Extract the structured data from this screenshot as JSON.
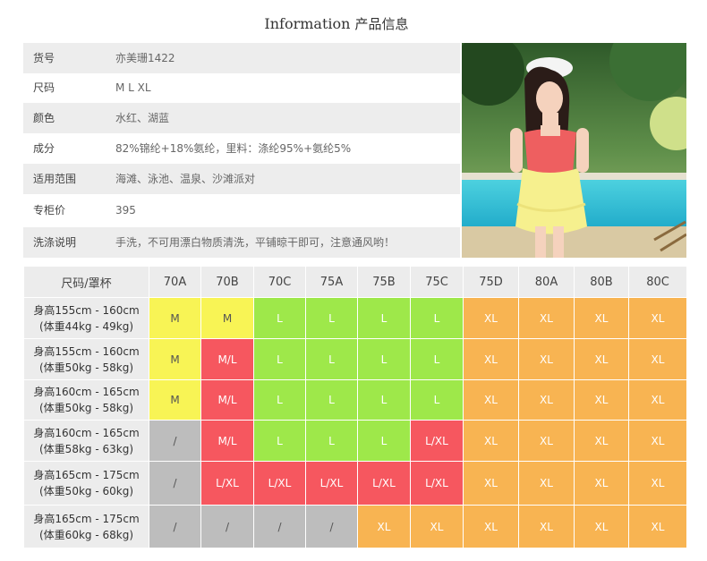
{
  "title": {
    "en": "Information",
    "zh": "产品信息"
  },
  "info": [
    {
      "label": "货号",
      "value": "亦美珊1422"
    },
    {
      "label": "尺码",
      "value": "M    L    XL"
    },
    {
      "label": "颜色",
      "value": "水红、湖蓝"
    },
    {
      "label": "成分",
      "value": "82%锦纶+18%氨纶，里料：涤纶95%+氨纶5%"
    },
    {
      "label": "适用范围",
      "value": "海滩、泳池、温泉、沙滩派对"
    },
    {
      "label": "专柜价",
      "value": "395"
    },
    {
      "label": "洗涤说明",
      "value": "手洗，不可用漂白物质清洗，平铺晾干即可，注意通风哟！"
    }
  ],
  "colors": {
    "yellow": "#f8f455",
    "red": "#f6575f",
    "green": "#9ee84a",
    "orange": "#f8b452",
    "gray": "#bdbdbd",
    "header": "#ececec"
  },
  "size_table": {
    "corner": "尺码/罩杯",
    "cups": [
      "70A",
      "70B",
      "70C",
      "75A",
      "75B",
      "75C",
      "75D",
      "80A",
      "80B",
      "80C"
    ],
    "rows": [
      {
        "height": "身高155cm - 160cm",
        "weight": "(体重44kg - 49kg)",
        "cells": [
          {
            "t": "M",
            "c": "yellow"
          },
          {
            "t": "M",
            "c": "yellow"
          },
          {
            "t": "L",
            "c": "green"
          },
          {
            "t": "L",
            "c": "green"
          },
          {
            "t": "L",
            "c": "green"
          },
          {
            "t": "L",
            "c": "green"
          },
          {
            "t": "XL",
            "c": "orange"
          },
          {
            "t": "XL",
            "c": "orange"
          },
          {
            "t": "XL",
            "c": "orange"
          },
          {
            "t": "XL",
            "c": "orange"
          }
        ]
      },
      {
        "height": "身高155cm - 160cm",
        "weight": "(体重50kg - 58kg)",
        "cells": [
          {
            "t": "M",
            "c": "yellow"
          },
          {
            "t": "M/L",
            "c": "red"
          },
          {
            "t": "L",
            "c": "green"
          },
          {
            "t": "L",
            "c": "green"
          },
          {
            "t": "L",
            "c": "green"
          },
          {
            "t": "L",
            "c": "green"
          },
          {
            "t": "XL",
            "c": "orange"
          },
          {
            "t": "XL",
            "c": "orange"
          },
          {
            "t": "XL",
            "c": "orange"
          },
          {
            "t": "XL",
            "c": "orange"
          }
        ]
      },
      {
        "height": "身高160cm - 165cm",
        "weight": "(体重50kg - 58kg)",
        "cells": [
          {
            "t": "M",
            "c": "yellow"
          },
          {
            "t": "M/L",
            "c": "red"
          },
          {
            "t": "L",
            "c": "green"
          },
          {
            "t": "L",
            "c": "green"
          },
          {
            "t": "L",
            "c": "green"
          },
          {
            "t": "L",
            "c": "green"
          },
          {
            "t": "XL",
            "c": "orange"
          },
          {
            "t": "XL",
            "c": "orange"
          },
          {
            "t": "XL",
            "c": "orange"
          },
          {
            "t": "XL",
            "c": "orange"
          }
        ]
      },
      {
        "height": "身高160cm - 165cm",
        "weight": "(体重58kg - 63kg)",
        "cells": [
          {
            "t": "/",
            "c": "gray"
          },
          {
            "t": "M/L",
            "c": "red"
          },
          {
            "t": "L",
            "c": "green"
          },
          {
            "t": "L",
            "c": "green"
          },
          {
            "t": "L",
            "c": "green"
          },
          {
            "t": "L/XL",
            "c": "red"
          },
          {
            "t": "XL",
            "c": "orange"
          },
          {
            "t": "XL",
            "c": "orange"
          },
          {
            "t": "XL",
            "c": "orange"
          },
          {
            "t": "XL",
            "c": "orange"
          }
        ]
      },
      {
        "height": "身高165cm - 175cm",
        "weight": "(体重50kg - 60kg)",
        "cells": [
          {
            "t": "/",
            "c": "gray"
          },
          {
            "t": "L/XL",
            "c": "red"
          },
          {
            "t": "L/XL",
            "c": "red"
          },
          {
            "t": "L/XL",
            "c": "red"
          },
          {
            "t": "L/XL",
            "c": "red"
          },
          {
            "t": "L/XL",
            "c": "red"
          },
          {
            "t": "XL",
            "c": "orange"
          },
          {
            "t": "XL",
            "c": "orange"
          },
          {
            "t": "XL",
            "c": "orange"
          },
          {
            "t": "XL",
            "c": "orange"
          }
        ]
      },
      {
        "height": "身高165cm - 175cm",
        "weight": "(体重60kg - 68kg)",
        "cells": [
          {
            "t": "/",
            "c": "gray"
          },
          {
            "t": "/",
            "c": "gray"
          },
          {
            "t": "/",
            "c": "gray"
          },
          {
            "t": "/",
            "c": "gray"
          },
          {
            "t": "XL",
            "c": "orange"
          },
          {
            "t": "XL",
            "c": "orange"
          },
          {
            "t": "XL",
            "c": "orange"
          },
          {
            "t": "XL",
            "c": "orange"
          },
          {
            "t": "XL",
            "c": "orange"
          },
          {
            "t": "XL",
            "c": "orange"
          }
        ]
      }
    ]
  }
}
